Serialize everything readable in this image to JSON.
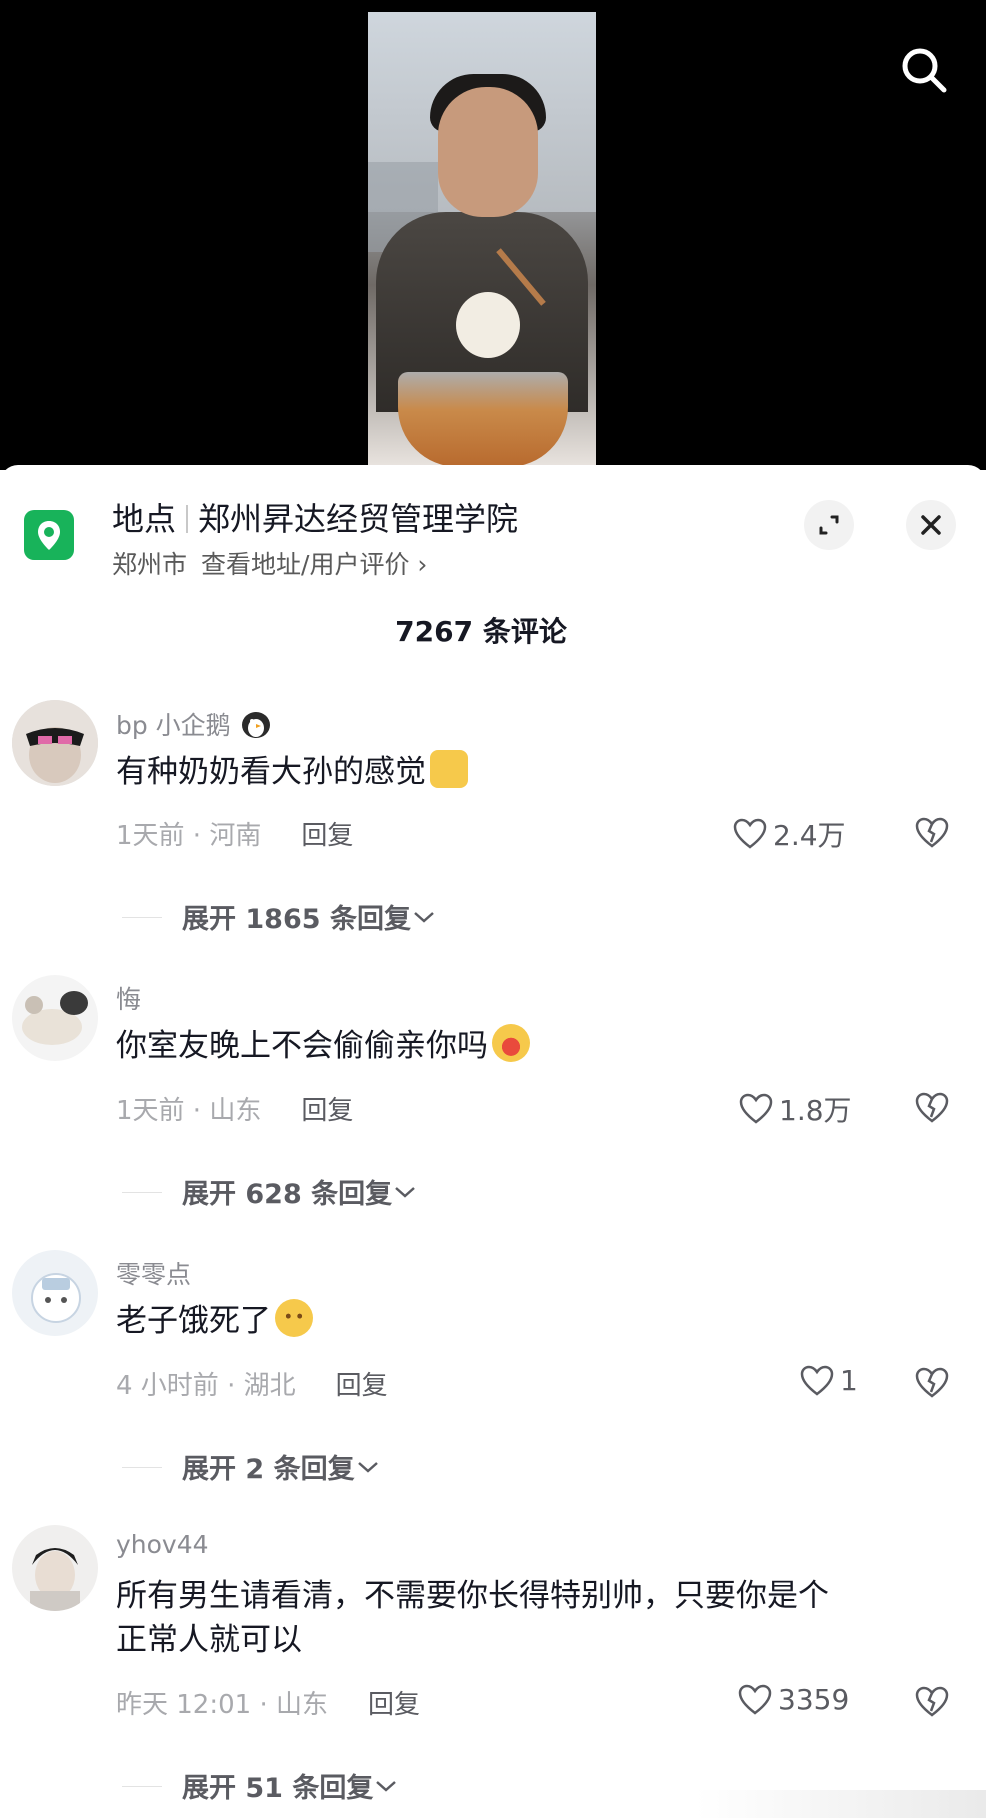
{
  "location": {
    "label": "地点",
    "name": "郑州昇达经贸管理学院",
    "city": "郑州市",
    "link": "查看地址/用户评价",
    "chevron": "›"
  },
  "comments_header": {
    "count_text": "7267 条评论"
  },
  "comments": [
    {
      "username": "bp 小企鹅",
      "username_emoji": "penguin-emoji",
      "text": "有种奶奶看大孙的感觉",
      "text_emoji": "victory-hand-emoji",
      "time_loc": "1天前 · 河南",
      "reply_label": "回复",
      "likes": "2.4万",
      "expand": "展开 1865 条回复"
    },
    {
      "username": "悔",
      "text": "你室友晚上不会偷偷亲你吗",
      "text_emoji": "kissing-face-emoji",
      "time_loc": "1天前 · 山东",
      "reply_label": "回复",
      "likes": "1.8万",
      "expand": "展开 628 条回复"
    },
    {
      "username": "零零点",
      "text": "老子饿死了",
      "text_emoji": "dizzy-face-emoji",
      "time_loc": "4 小时前 · 湖北",
      "reply_label": "回复",
      "likes": "1",
      "expand": "展开 2 条回复"
    },
    {
      "username": "yhov44",
      "text_line1": "所有男生请看清，不需要你长得特别帅，只要你是个",
      "text_line2": "正常人就可以",
      "time_loc": "昨天 12:01 · 山东",
      "reply_label": "回复",
      "likes": "3359",
      "expand": "展开 51 条回复"
    }
  ],
  "icons": {
    "search": "search-icon",
    "location": "location-pin-icon",
    "expand": "expand-icon",
    "close": "close-icon",
    "like": "heart-icon",
    "dislike": "broken-heart-icon",
    "chevron": "chevron-down-icon"
  },
  "colors": {
    "location_green": "#18b35a",
    "text_primary": "#161823",
    "text_secondary": "#8a8b91"
  }
}
